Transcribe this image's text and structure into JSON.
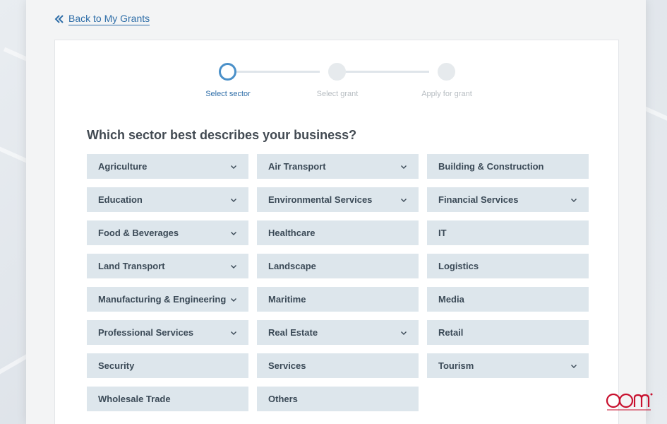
{
  "nav": {
    "back_label": "Back to My Grants"
  },
  "stepper": {
    "steps": [
      {
        "label": "Select sector",
        "active": true
      },
      {
        "label": "Select grant",
        "active": false
      },
      {
        "label": "Apply for grant",
        "active": false
      }
    ]
  },
  "question": "Which sector best describes your business?",
  "sectors": [
    {
      "label": "Agriculture",
      "has_dropdown": true
    },
    {
      "label": "Air Transport",
      "has_dropdown": true
    },
    {
      "label": "Building & Construction",
      "has_dropdown": false
    },
    {
      "label": "Education",
      "has_dropdown": true
    },
    {
      "label": "Environmental Services",
      "has_dropdown": true
    },
    {
      "label": "Financial Services",
      "has_dropdown": true
    },
    {
      "label": "Food & Beverages",
      "has_dropdown": true
    },
    {
      "label": "Healthcare",
      "has_dropdown": false
    },
    {
      "label": "IT",
      "has_dropdown": false
    },
    {
      "label": "Land Transport",
      "has_dropdown": true
    },
    {
      "label": "Landscape",
      "has_dropdown": false
    },
    {
      "label": "Logistics",
      "has_dropdown": false
    },
    {
      "label": "Manufacturing & Engineering",
      "has_dropdown": true
    },
    {
      "label": "Maritime",
      "has_dropdown": false
    },
    {
      "label": "Media",
      "has_dropdown": false
    },
    {
      "label": "Professional Services",
      "has_dropdown": true
    },
    {
      "label": "Real Estate",
      "has_dropdown": true
    },
    {
      "label": "Retail",
      "has_dropdown": false
    },
    {
      "label": "Security",
      "has_dropdown": false
    },
    {
      "label": "Services",
      "has_dropdown": false
    },
    {
      "label": "Tourism",
      "has_dropdown": true
    },
    {
      "label": "Wholesale Trade",
      "has_dropdown": false
    },
    {
      "label": "Others",
      "has_dropdown": false
    }
  ],
  "logo": {
    "text": "OOm",
    "icon": "oom-logo-icon",
    "color": "#c8102e"
  },
  "colors": {
    "accent": "#2f6ea8",
    "active_step": "#4a90c9",
    "tile_bg": "#dde6ec"
  }
}
